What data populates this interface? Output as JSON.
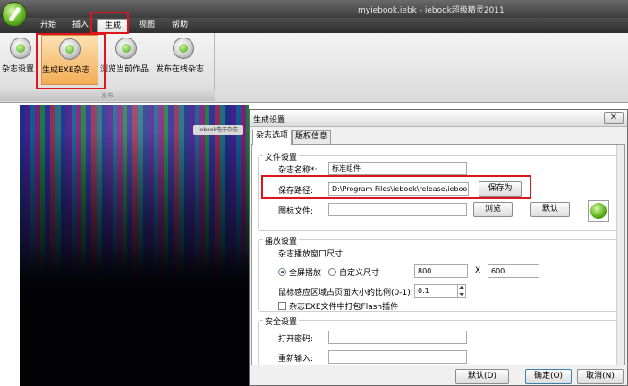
{
  "window": {
    "title": "myiebook.iebk - iebook超级精灵2011"
  },
  "menu_tabs": [
    {
      "label": "开始"
    },
    {
      "label": "插入"
    },
    {
      "label": "生成",
      "active": true
    },
    {
      "label": "视图"
    },
    {
      "label": "帮助"
    }
  ],
  "ribbon": {
    "buttons": [
      {
        "label": "杂志设置",
        "icon": "gear-icon"
      },
      {
        "label": "生成EXE杂志",
        "icon": "play-icon",
        "active": true
      },
      {
        "label": "浏览当前作品",
        "icon": "browse-icon"
      },
      {
        "label": "发布在线杂志",
        "icon": "refresh-icon"
      }
    ],
    "group_label": "发布"
  },
  "preview": {
    "badge_text": "iebook电子杂志"
  },
  "dialog": {
    "title": "生成设置",
    "close_symbol": "✕",
    "tabs": [
      {
        "label": "杂志选项",
        "active": true
      },
      {
        "label": "版权信息"
      }
    ],
    "file_settings": {
      "legend": "文件设置",
      "name_label": "杂志名称*:",
      "name_value": "标准组件",
      "path_label": "保存路径:",
      "path_value": "D:\\Program Files\\iebook\\release\\iebook.exe",
      "save_as_label": "保存为",
      "icon_label": "图标文件:",
      "icon_value": "",
      "browse_label": "浏览",
      "default_label": "默认"
    },
    "playback_settings": {
      "legend": "播放设置",
      "window_size_label": "杂志播放窗口尺寸:",
      "fullscreen_label": "全屏播放",
      "custom_size_label": "自定义尺寸",
      "width_value": "800",
      "x_label": "X",
      "height_value": "600",
      "ratio_label": "鼠标感应区域占页面大小的比例(0-1):",
      "ratio_value": "0.1",
      "flash_checkbox_label": "杂志EXE文件中打包Flash插件"
    },
    "security_settings": {
      "legend": "安全设置",
      "password_label": "打开密码:",
      "reenter_label": "重新输入:"
    },
    "footer": {
      "default_label": "默认(D)",
      "ok_label": "确定(O)",
      "cancel_label": "取消(N)"
    }
  }
}
